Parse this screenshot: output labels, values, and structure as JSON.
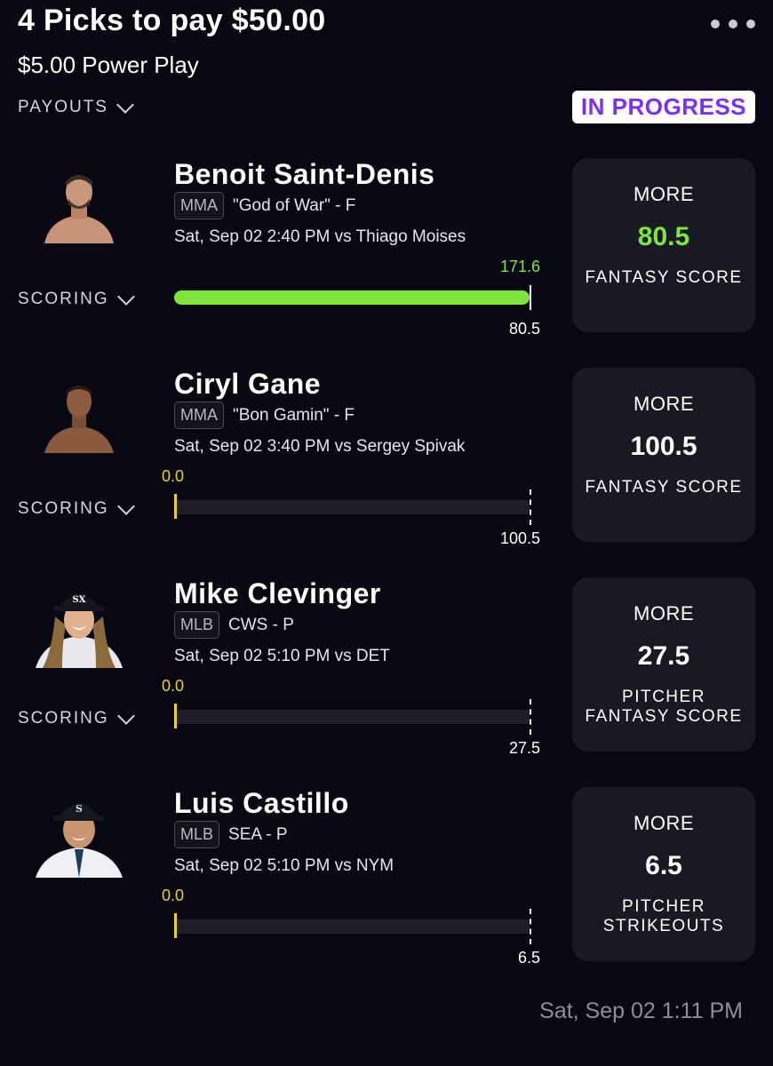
{
  "header": {
    "title": "4 Picks to pay $50.00",
    "subtitle": "$5.00 Power Play",
    "payouts_label": "PAYOUTS",
    "status": "IN PROGRESS"
  },
  "colors": {
    "background": "#070811",
    "card": "#181923",
    "progress_green": "#7ee63a",
    "current_yellow": "#e8d21f",
    "status_purple": "#7b2ff7"
  },
  "picks": [
    {
      "name": "Benoit Saint-Denis",
      "league": "MMA",
      "detail": "\"God of War\" - F",
      "game": "Sat, Sep 02 2:40 PM  vs Thiago Moises",
      "current": "171.6",
      "line": "80.5",
      "scoring_label": "SCORING",
      "direction": "MORE",
      "stat_line1": "FANTASY SCORE",
      "stat_line2": "",
      "progress": 1.0
    },
    {
      "name": "Ciryl Gane",
      "league": "MMA",
      "detail": "\"Bon Gamin\" - F",
      "game": "Sat, Sep 02 3:40 PM  vs Sergey Spivak",
      "current": "0.0",
      "line": "100.5",
      "scoring_label": "SCORING",
      "direction": "MORE",
      "stat_line1": "FANTASY SCORE",
      "stat_line2": "",
      "progress": 0
    },
    {
      "name": "Mike Clevinger",
      "league": "MLB",
      "detail": "CWS - P",
      "game": "Sat, Sep 02 5:10 PM  vs DET",
      "current": "0.0",
      "line": "27.5",
      "scoring_label": "SCORING",
      "direction": "MORE",
      "stat_line1": "PITCHER",
      "stat_line2": "FANTASY SCORE",
      "progress": 0
    },
    {
      "name": "Luis Castillo",
      "league": "MLB",
      "detail": "SEA - P",
      "game": "Sat, Sep 02 5:10 PM  vs NYM",
      "current": "0.0",
      "line": "6.5",
      "scoring_label": "",
      "direction": "MORE",
      "stat_line1": "PITCHER",
      "stat_line2": "STRIKEOUTS",
      "progress": 0
    }
  ],
  "footer": {
    "timestamp": "Sat, Sep 02 1:11 PM"
  }
}
